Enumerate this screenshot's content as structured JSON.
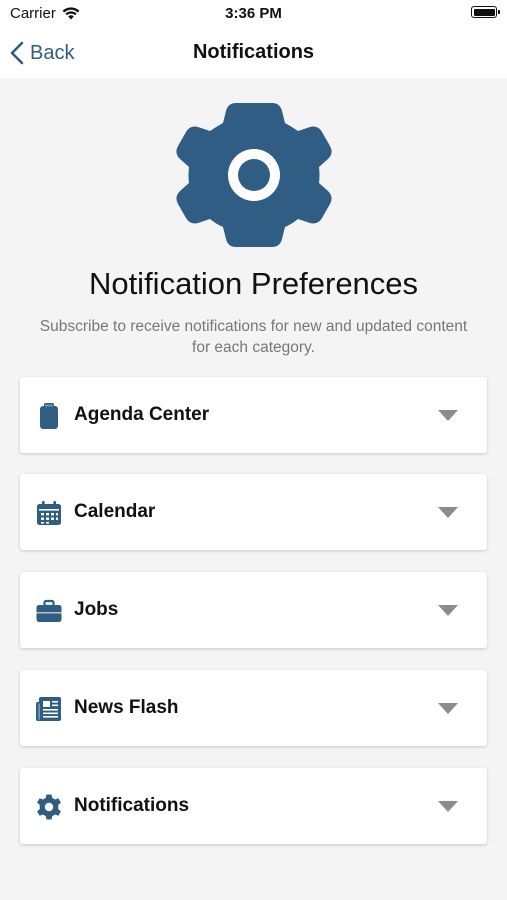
{
  "status_bar": {
    "carrier": "Carrier",
    "time": "3:36 PM"
  },
  "nav": {
    "back_label": "Back",
    "title": "Notifications"
  },
  "hero": {
    "icon": "gear-icon",
    "title": "Notification Preferences",
    "subtitle": "Subscribe to receive notifications for new and updated content for each category."
  },
  "categories": [
    {
      "label": "Agenda Center",
      "icon": "clipboard-icon"
    },
    {
      "label": "Calendar",
      "icon": "calendar-icon"
    },
    {
      "label": "Jobs",
      "icon": "briefcase-icon"
    },
    {
      "label": "News Flash",
      "icon": "newspaper-icon"
    },
    {
      "label": "Notifications",
      "icon": "gear-icon"
    }
  ],
  "colors": {
    "accent": "#2f5d84",
    "background": "#f4f4f4",
    "caret": "#8c8c8c"
  }
}
